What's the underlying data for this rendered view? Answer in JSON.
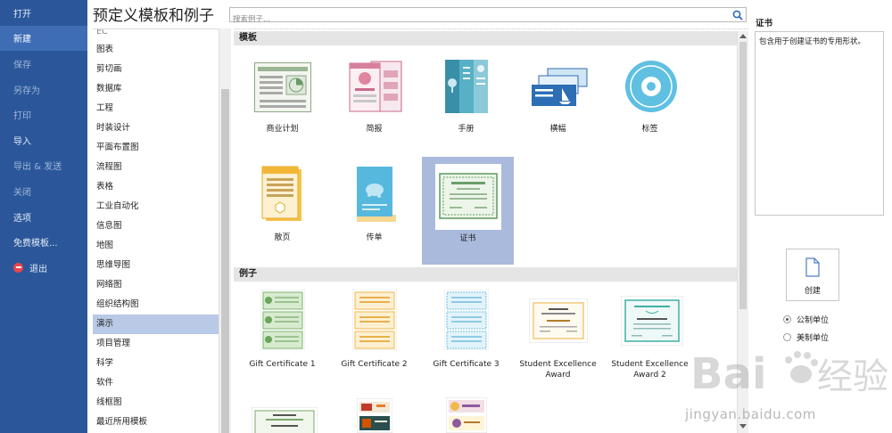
{
  "nav": {
    "items": [
      {
        "label": "打开",
        "state": "normal"
      },
      {
        "label": "新建",
        "state": "active"
      },
      {
        "label": "保存",
        "state": "dim"
      },
      {
        "label": "另存为",
        "state": "dim"
      },
      {
        "label": "打印",
        "state": "dim"
      },
      {
        "label": "导入",
        "state": "normal"
      },
      {
        "label": "导出 & 发送",
        "state": "dim"
      },
      {
        "label": "关闭",
        "state": "dim"
      },
      {
        "label": "选项",
        "state": "normal"
      },
      {
        "label": "免费模板...",
        "state": "normal"
      },
      {
        "label": "退出",
        "state": "normal",
        "icon": "exit-icon"
      }
    ]
  },
  "page_title": "预定义模板和例子",
  "search": {
    "placeholder": "搜索例子..."
  },
  "categories": {
    "partial_label": "EC",
    "items": [
      "图表",
      "剪切画",
      "数据库",
      "工程",
      "时装设计",
      "平面布置图",
      "流程图",
      "表格",
      "工业自动化",
      "信息图",
      "地图",
      "思维导图",
      "网络图",
      "组织结构图",
      "演示",
      "项目管理",
      "科学",
      "软件",
      "线框图",
      "最近所用模板"
    ],
    "selected_index": 14
  },
  "gallery": {
    "templates_header": "模板",
    "templates": [
      "商业计划",
      "简报",
      "手册",
      "横幅",
      "标签",
      "散页",
      "传单",
      "证书"
    ],
    "selected_template": "证书",
    "examples_header": "例子",
    "examples": [
      "Gift Certificate 1",
      "Gift Certificate 2",
      "Gift Certificate 3",
      "Student Excellence Award",
      "Student Excellence Award 2"
    ]
  },
  "detail": {
    "title": "证书",
    "description": "包含用于创建证书的专用形状。"
  },
  "create_button": {
    "label": "创建"
  },
  "units": [
    {
      "label": "公制单位",
      "checked": true
    },
    {
      "label": "美制单位",
      "checked": false
    }
  ],
  "watermark": {
    "text": "Baidu经验",
    "sub": "jingyan.baidu.com"
  },
  "colors": {
    "nav_bg": "#2b579a",
    "nav_active": "#3e6db5",
    "selection": "#a9badc",
    "exit_icon": "#e8464e"
  }
}
